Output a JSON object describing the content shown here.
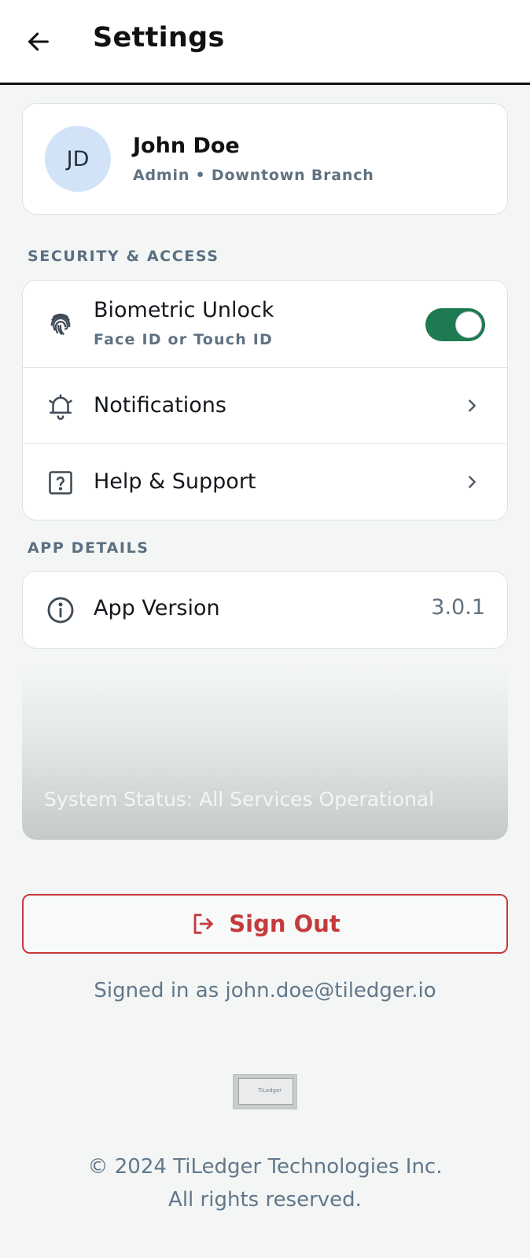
{
  "header": {
    "title": "Settings",
    "back_icon": "arrow-left-icon"
  },
  "profile": {
    "initials": "JD",
    "name": "John Doe",
    "role": "Admin • Downtown Branch"
  },
  "sections": {
    "security_label": "SECURITY & ACCESS",
    "app_details_label": "APP DETAILS"
  },
  "security": {
    "biometric": {
      "icon": "fingerprint-icon",
      "label": "Biometric Unlock",
      "sub": "Face ID or Touch ID",
      "enabled": true
    },
    "notifications": {
      "icon": "bell-icon",
      "label": "Notifications"
    },
    "help": {
      "icon": "help-square-icon",
      "label": "Help & Support"
    }
  },
  "app_details": {
    "version_icon": "info-icon",
    "version_label": "App Version",
    "version_value": "3.0.1"
  },
  "status": {
    "text": "System Status: All Services Operational"
  },
  "signout": {
    "icon": "logout-icon",
    "label": "Sign Out"
  },
  "signed_in_as": "Signed in as john.doe@tiledger.io",
  "logo": {
    "text": "TiLedger"
  },
  "footer": {
    "line1": "© 2024 TiLedger Technologies Inc.",
    "line2": "All rights reserved."
  },
  "colors": {
    "accent_green": "#1e7a50",
    "danger_red": "#c53a3a",
    "muted_text": "#5f7283",
    "background": "#f3f6f5"
  }
}
